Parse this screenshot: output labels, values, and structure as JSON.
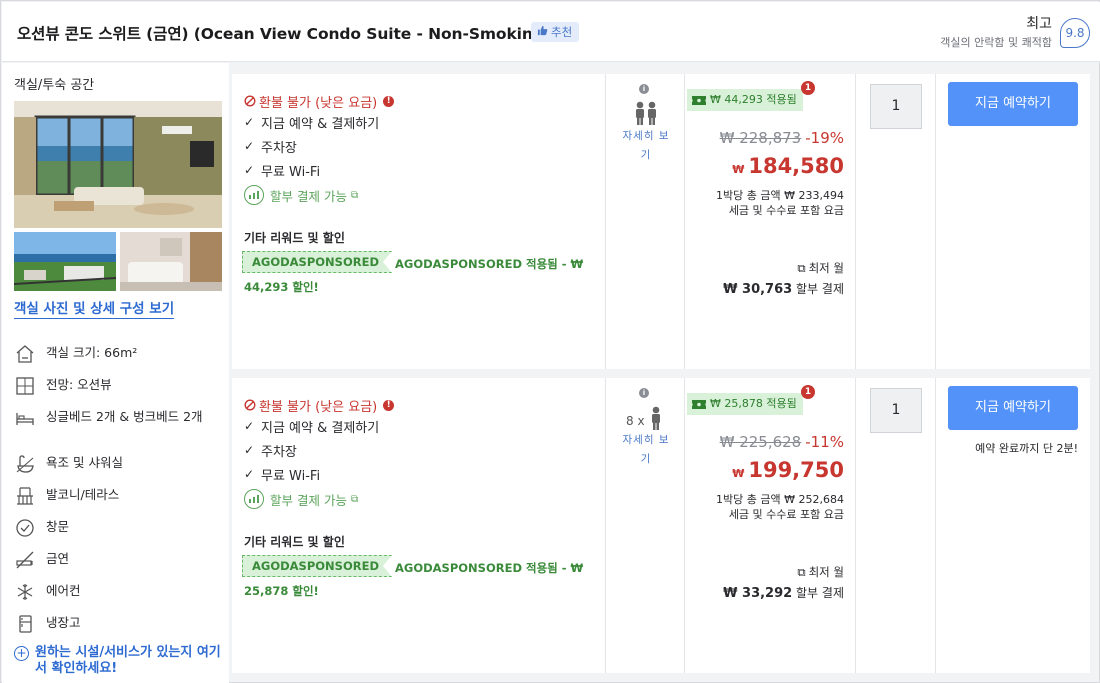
{
  "header": {
    "room_title": "오션뷰 콘도 스위트 (금연) (Ocean View Condo Suite - Non-Smoking)",
    "recommend_badge": "추천",
    "score_label": "최고",
    "score_sub": "객실의 안락함 및 쾌적함",
    "score": "9.8"
  },
  "left": {
    "title": "객실/투숙 공간",
    "photo_link": "객실 사진 및 상세 구성 보기",
    "amenities": [
      {
        "icon": "room-size-icon",
        "label": "객실 크기: 66m²"
      },
      {
        "icon": "view-icon",
        "label": "전망: 오션뷰"
      },
      {
        "icon": "bed-icon",
        "label": "싱글베드 2개 & 벙크베드 2개"
      },
      {
        "icon": "bath-shower-icon",
        "label": "욕조 및 샤워실"
      },
      {
        "icon": "balcony-icon",
        "label": "발코니/테라스"
      },
      {
        "icon": "window-icon",
        "label": "창문"
      },
      {
        "icon": "no-smoking-icon",
        "label": "금연"
      },
      {
        "icon": "air-conditioner-icon",
        "label": "에어컨"
      },
      {
        "icon": "refrigerator-icon",
        "label": "냉장고"
      }
    ],
    "facility_link": "원하는 시설/서비스가 있는지 여기서 확인하세요!"
  },
  "offers": [
    {
      "refund": "환불 불가 (낮은 요금)",
      "benefits": [
        "지금 예약 & 결제하기",
        "주차장",
        "무료 Wi-Fi"
      ],
      "installment": "할부 결제 가능",
      "other_title": "기타 리워드 및 할인",
      "sponsored_tag": "AGODASPONSORED",
      "sponsored_text": "AGODASPONSORED 적용됨 - ₩",
      "sponsored_text2": "44,293 할인!",
      "occupancy_mult": "",
      "occupancy_link": "자세히 보기",
      "coupon": "₩ 44,293 적용됨",
      "coupon_badge": "1",
      "original_price": "₩ 228,873",
      "discount_pct": "-19%",
      "currency": "₩",
      "final_price": "184,580",
      "total_line1": "1박당 총 금액 ₩ 233,494",
      "total_line2": "세금 및 수수료 포함 요금",
      "month_label": "최저 월",
      "monthly_amount": "₩ 30,763",
      "monthly_suffix": "할부 결제",
      "quantity": "1",
      "book_label": "지금 예약하기",
      "hint": ""
    },
    {
      "refund": "환불 불가 (낮은 요금)",
      "benefits": [
        "지금 예약 & 결제하기",
        "주차장",
        "무료 Wi-Fi"
      ],
      "installment": "할부 결제 가능",
      "other_title": "기타 리워드 및 할인",
      "sponsored_tag": "AGODASPONSORED",
      "sponsored_text": "AGODASPONSORED 적용됨 - ₩",
      "sponsored_text2": "25,878 할인!",
      "occupancy_mult": "8 x",
      "occupancy_link": "자세히 보기",
      "coupon": "₩ 25,878 적용됨",
      "coupon_badge": "1",
      "original_price": "₩ 225,628",
      "discount_pct": "-11%",
      "currency": "₩",
      "final_price": "199,750",
      "total_line1": "1박당 총 금액 ₩ 252,684",
      "total_line2": "세금 및 수수료 포함 요금",
      "month_label": "최저 월",
      "monthly_amount": "₩ 33,292",
      "monthly_suffix": "할부 결제",
      "quantity": "1",
      "book_label": "지금 예약하기",
      "hint": "예약 완료까지 단 2분!"
    }
  ],
  "colors": {
    "accent_blue": "#2d6ad1",
    "button_blue": "#5392f8",
    "price_red": "#c7362f",
    "sponsored_green": "#3a8a3a"
  }
}
